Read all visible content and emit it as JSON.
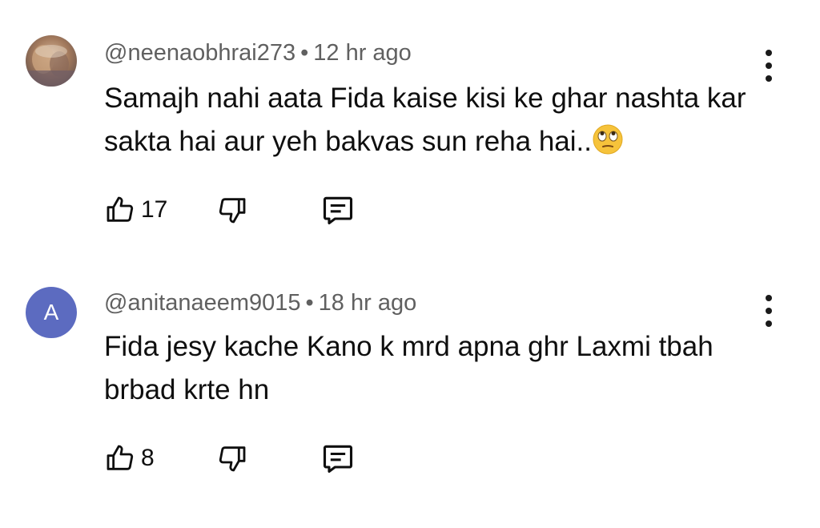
{
  "comments": [
    {
      "author": "@neenaobhrai273",
      "separator": "•",
      "time": "12 hr ago",
      "text": "Samajh nahi aata Fida kaise kisi ke ghar nashta kar sakta hai aur yeh bakvas sun reha hai..",
      "emoji": "face-with-rolling-eyes",
      "likes": "17",
      "avatar": "photo-avatar"
    },
    {
      "author": "@anitanaeem9015",
      "separator": "•",
      "time": "18 hr ago",
      "text": "Fida jesy kache Kano k mrd apna ghr Laxmi tbah brbad krte hn",
      "likes": "8",
      "avatar_letter": "A",
      "avatar_color": "#5c6bc0"
    }
  ],
  "icons": {
    "like": "thumbs-up-icon",
    "dislike": "thumbs-down-icon",
    "reply": "comment-icon",
    "menu": "more-vert-icon"
  }
}
